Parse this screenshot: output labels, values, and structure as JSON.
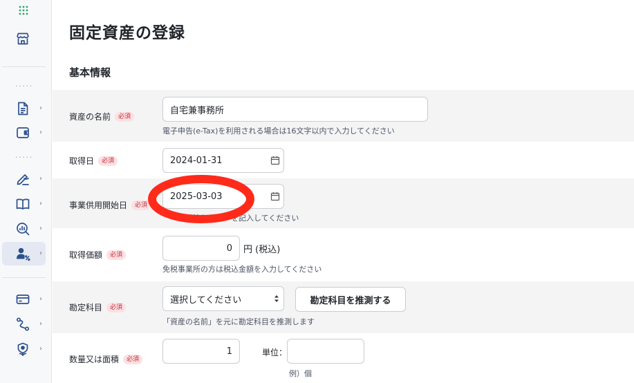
{
  "page": {
    "title": "固定資産の登録"
  },
  "section": {
    "title": "基本情報"
  },
  "sidebar": {
    "items": [
      {
        "icon": "apps-grid-icon"
      },
      {
        "icon": "store-icon"
      },
      {
        "icon": "document-icon",
        "chevron": "›"
      },
      {
        "icon": "wallet-icon",
        "chevron": "›"
      },
      {
        "icon": "signature-icon",
        "chevron": "›"
      },
      {
        "icon": "book-icon",
        "chevron": "›"
      },
      {
        "icon": "analytics-search-icon",
        "chevron": "›"
      },
      {
        "icon": "user-percent-icon",
        "chevron": "›",
        "active": true
      },
      {
        "icon": "card-icon",
        "chevron": "›"
      },
      {
        "icon": "route-icon",
        "chevron": "›"
      },
      {
        "icon": "shield-plant-icon",
        "chevron": "›"
      }
    ],
    "dots": "....."
  },
  "form": {
    "required_badge": "必須",
    "asset_name": {
      "label": "資産の名前",
      "value": "自宅兼事務所",
      "help": "電子申告(e-Tax)を利用される場合は16文字以内で入力してください"
    },
    "acquired_date": {
      "label": "取得日",
      "value": "2024-01-31"
    },
    "business_start_date": {
      "label": "事業供用開始日",
      "value": "2025-03-03",
      "help": "使用を開始した日付を記入してください",
      "help_visible": "　　を開始した　　を記入してください"
    },
    "acquisition_cost": {
      "label": "取得価額",
      "value": "0",
      "unit": "円 (税込)",
      "help": "免税事業所の方は税込金額を入力してください"
    },
    "account": {
      "label": "勘定科目",
      "selected": "選択してください",
      "guess_button": "勘定科目を推測する",
      "help": "「資産の名前」を元に勘定科目を推測します"
    },
    "quantity": {
      "label": "数量又は面積",
      "value": "1",
      "unit_label": "単位：",
      "unit_value": "",
      "unit_example": "例）個"
    }
  },
  "colors": {
    "accent": "#2f6fdf",
    "required_text": "#c62f3a",
    "required_bg": "#fbe1e3",
    "annotation": "#ff2a1a"
  }
}
